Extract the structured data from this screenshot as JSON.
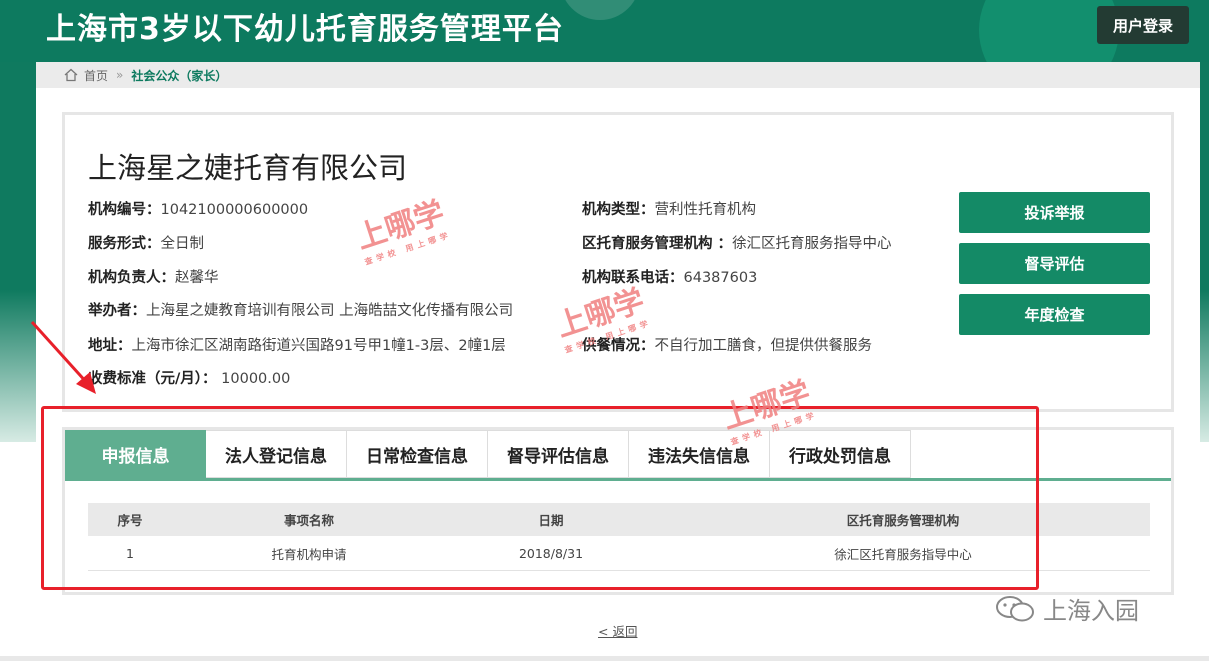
{
  "header": {
    "title": "上海市3岁以下幼儿托育服务管理平台",
    "login_label": "用户登录"
  },
  "breadcrumb": {
    "home": "首页",
    "separator": "»",
    "current": "社会公众（家长）",
    "home_icon": "home-icon"
  },
  "org": {
    "name": "上海星之婕托育有限公司",
    "left": [
      {
        "label": "机构编号：",
        "value": "1042100000600000"
      },
      {
        "label": "服务形式：",
        "value": "全日制"
      },
      {
        "label": "机构负责人：",
        "value": "赵馨华"
      },
      {
        "label": "举办者：",
        "value": "上海星之婕教育培训有限公司 上海皓喆文化传播有限公司"
      },
      {
        "label": "地址：",
        "value": "上海市徐汇区湖南路街道兴国路91号甲1幢1-3层、2幢1层"
      },
      {
        "label": "收费标准（元/月）：",
        "value": " 10000.00"
      }
    ],
    "right": [
      {
        "label": "机构类型：",
        "value": "营利性托育机构"
      },
      {
        "label": "区托育服务管理机构 ：",
        "value": "徐汇区托育服务指导中心"
      },
      {
        "label": "机构联系电话：",
        "value": "64387603"
      },
      {
        "label": "供餐情况：",
        "value": "不自行加工膳食，但提供供餐服务"
      }
    ]
  },
  "actions": {
    "complaint": "投诉举报",
    "supervision": "督导评估",
    "annual": "年度检查"
  },
  "tabs": [
    "申报信息",
    "法人登记信息",
    "日常检查信息",
    "督导评估信息",
    "违法失信信息",
    "行政处罚信息"
  ],
  "table": {
    "headers": [
      "序号",
      "事项名称",
      "日期",
      "区托育服务管理机构"
    ],
    "rows": [
      [
        "1",
        "托育机构申请",
        "2018/8/31",
        "徐汇区托育服务指导中心"
      ]
    ]
  },
  "back_label": "< 返回",
  "watermark": {
    "big": "上哪学",
    "small": "查学校 用上哪学"
  },
  "wechat_label": "上海入园",
  "colors": {
    "primary": "#0d7a5f",
    "accent": "#148a66",
    "tab_active": "#5fae90",
    "highlight": "#e8202a"
  }
}
